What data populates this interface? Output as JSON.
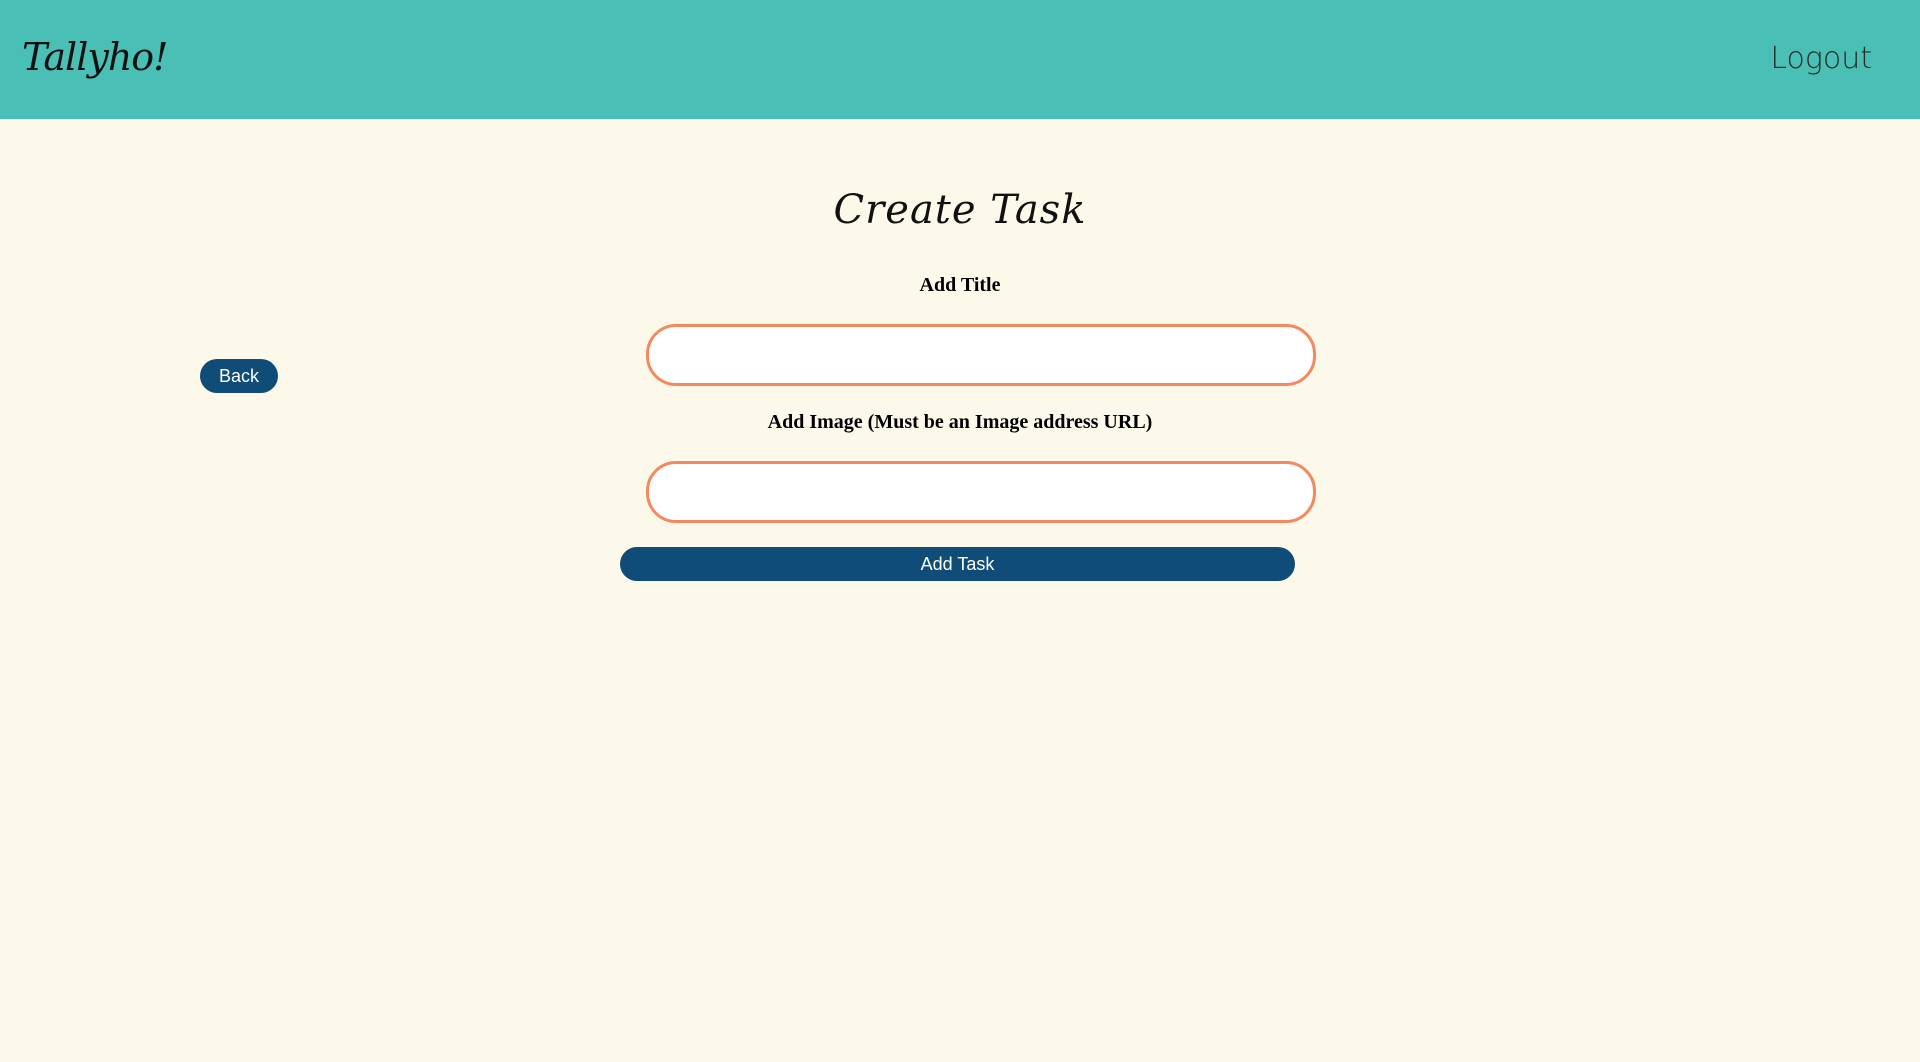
{
  "header": {
    "brand": "Tallyho!",
    "logout_label": "Logout"
  },
  "colors": {
    "header_bg": "#4abfb6",
    "page_bg": "#fcf8ea",
    "input_border": "#f4895f",
    "button_bg": "#0f4c77"
  },
  "main": {
    "title": "Create Task",
    "back_label": "Back",
    "fields": {
      "title": {
        "label": "Add Title",
        "value": "",
        "placeholder": ""
      },
      "image": {
        "label": "Add Image (Must be an Image address URL)",
        "value": "",
        "placeholder": ""
      }
    },
    "submit_label": "Add Task"
  }
}
